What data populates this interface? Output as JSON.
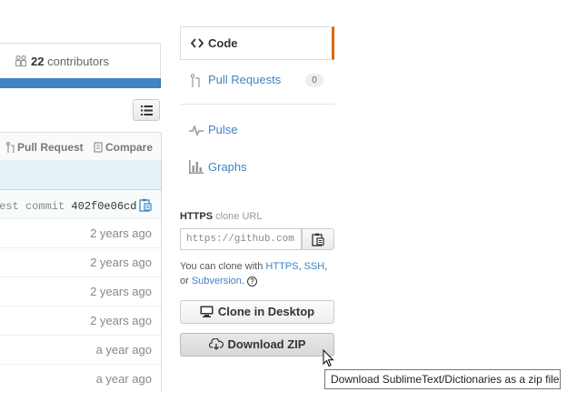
{
  "summary": {
    "contributors_count": "22",
    "contributors_label": "contributors"
  },
  "toolbar": {
    "pull_request_label": "Pull Request",
    "compare_label": "Compare"
  },
  "latest_commit": {
    "prefix": "test commit",
    "hash": "402f0e06cd"
  },
  "file_rows": [
    {
      "age": "2 years ago"
    },
    {
      "age": "2 years ago"
    },
    {
      "age": "2 years ago"
    },
    {
      "age": "2 years ago"
    },
    {
      "age": "a year ago"
    },
    {
      "age": "a year ago"
    }
  ],
  "nav": {
    "code": "Code",
    "pull_requests": "Pull Requests",
    "pull_requests_count": "0",
    "pulse": "Pulse",
    "graphs": "Graphs"
  },
  "clone": {
    "protocol": "HTTPS",
    "label": "clone URL",
    "url": "https://github.com/SublimeText/Dictionaries.git",
    "help_prefix": "You can clone with",
    "https_link": "HTTPS",
    "ssh_link": "SSH",
    "or_text": "or",
    "subversion_link": "Subversion",
    "desktop_button": "Clone in Desktop",
    "zip_button": "Download ZIP"
  },
  "tooltip": {
    "text": "Download SublimeText/Dictionaries as a zip file"
  },
  "colors": {
    "link": "#4183c4",
    "accent": "#d26911",
    "bar": "#4183c4"
  }
}
